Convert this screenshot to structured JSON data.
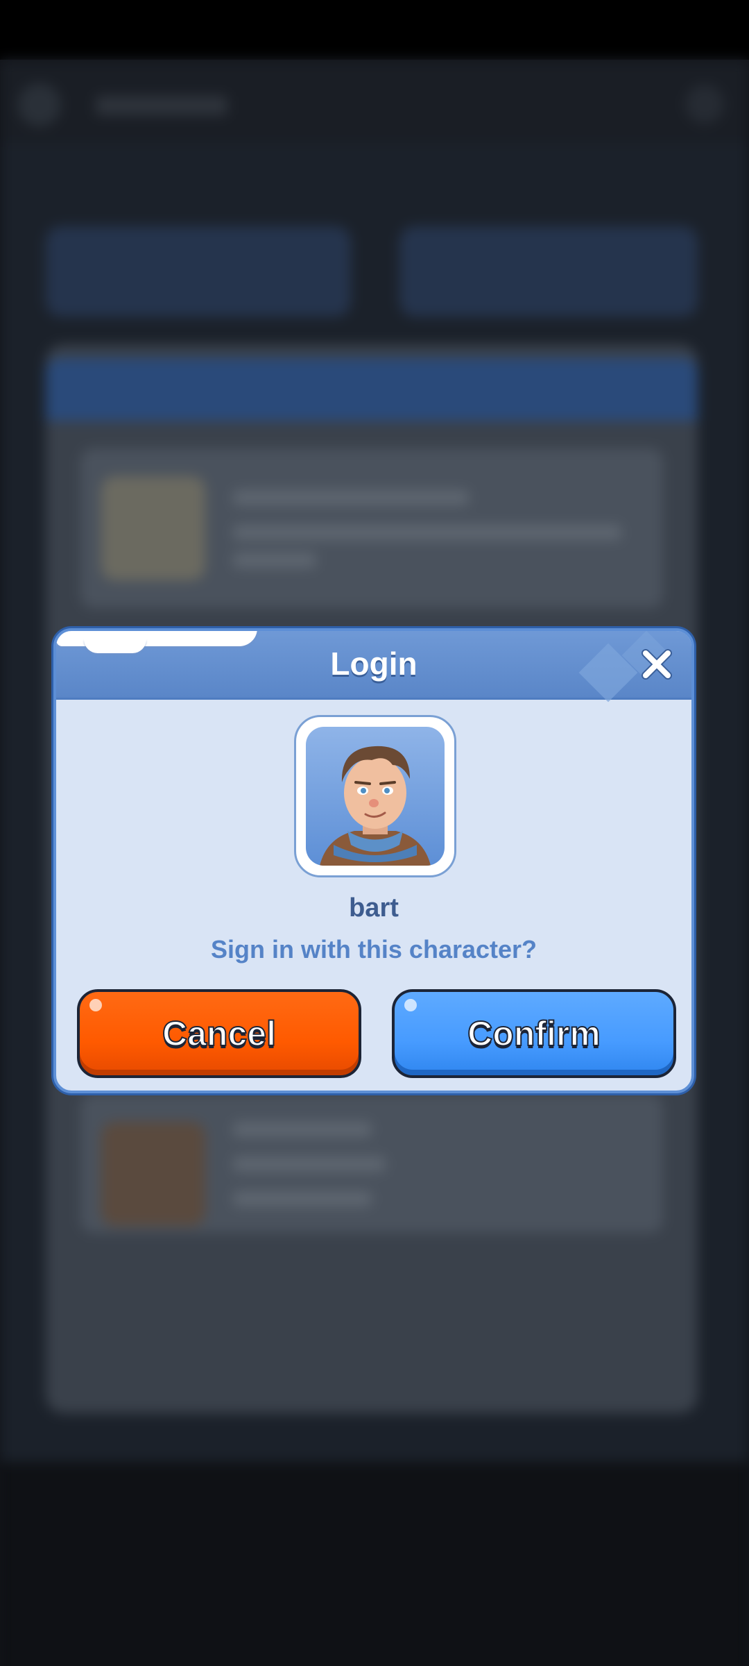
{
  "dialog": {
    "title": "Login",
    "character_name": "bart",
    "prompt": "Sign in with this character?",
    "cancel_label": "Cancel",
    "confirm_label": "Confirm"
  },
  "icons": {
    "close": "close-icon",
    "avatar": "character-portrait"
  },
  "colors": {
    "cancel_button": "#ff5a00",
    "confirm_button": "#479bff",
    "dialog_background": "#d9e4f5",
    "header_background": "#5a86c8",
    "name_text": "#3d5c8f",
    "prompt_text": "#5583c7"
  }
}
